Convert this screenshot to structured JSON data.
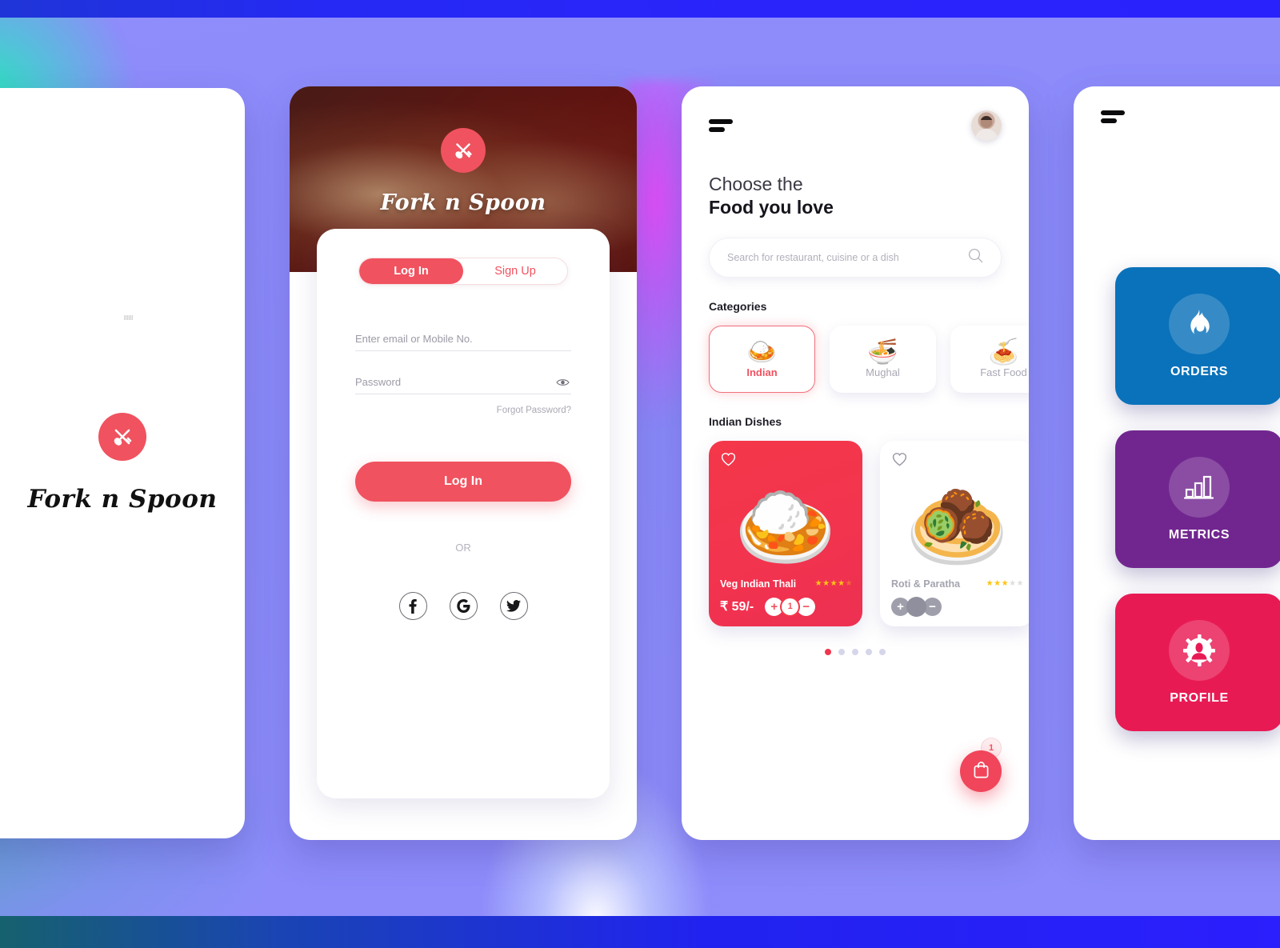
{
  "theme": {
    "accent": "#f0525f",
    "featured_card": "#f2344e",
    "star": "#ffc412",
    "bg_purple": "#8b8bfa",
    "bg_band_blue": "#2a24fb",
    "bg_teal": "#27e6b8",
    "bg_magenta": "#e24ff8"
  },
  "brand": {
    "name": "Fork n Spoon",
    "logo_icon": "fork-spoon-pin-icon"
  },
  "splash": {
    "brand": "Fork n Spoon"
  },
  "login": {
    "brand": "Fork n Spoon",
    "tabs": [
      {
        "label": "Log In",
        "active": true
      },
      {
        "label": "Sign Up",
        "active": false
      }
    ],
    "email_placeholder": "Enter email or Mobile No.",
    "email_value": "",
    "password_placeholder": "Password",
    "password_value": "",
    "show_password_icon": "eye-icon",
    "forgot_label": "Forgot Password?",
    "submit_label": "Log In",
    "divider_label": "OR",
    "socials": [
      {
        "name": "facebook",
        "glyph": "f"
      },
      {
        "name": "google",
        "glyph": "G"
      },
      {
        "name": "twitter",
        "glyph": "🐦"
      }
    ]
  },
  "home": {
    "menu_icon": "hamburger-icon",
    "avatar_icon": "user-avatar",
    "heading_line1": "Choose the",
    "heading_line2": "Food you love",
    "search": {
      "placeholder": "Search for restaurant, cuisine or a dish",
      "value": "",
      "icon": "search-icon"
    },
    "categories_title": "Categories",
    "categories": [
      {
        "label": "Indian",
        "emoji": "🍛",
        "active": true
      },
      {
        "label": "Mughal",
        "emoji": "🍜",
        "active": false
      },
      {
        "label": "Fast Food",
        "emoji": "🍝",
        "active": false
      }
    ],
    "dishes_title": "Indian Dishes",
    "dishes": [
      {
        "name": "Veg Indian Thali",
        "price": "₹ 59/-",
        "emoji": "🍛",
        "rating": 4,
        "rating_max": 5,
        "featured": true,
        "favorite_icon": "heart-icon",
        "quantity": "1",
        "increase_label": "+",
        "decrease_label": "−"
      },
      {
        "name": "Roti & Paratha",
        "price": "",
        "emoji": "🧆",
        "rating": 3,
        "rating_max": 5,
        "featured": false,
        "favorite_icon": "heart-icon",
        "quantity": "",
        "increase_label": "+",
        "decrease_label": "−"
      }
    ],
    "pagination": {
      "count": 5,
      "active_index": 0
    },
    "cart": {
      "icon": "shopping-bag-icon",
      "badge": "1"
    }
  },
  "menu_screen": {
    "menu_icon": "hamburger-icon",
    "tiles": [
      {
        "label": "ORDERS",
        "icon": "flame-icon",
        "color": "#0a72ba"
      },
      {
        "label": "METRICS",
        "icon": "bar-chart-icon",
        "color": "#71268f"
      },
      {
        "label": "PROFILE",
        "icon": "gear-user-icon",
        "color": "#e81a54"
      }
    ]
  }
}
